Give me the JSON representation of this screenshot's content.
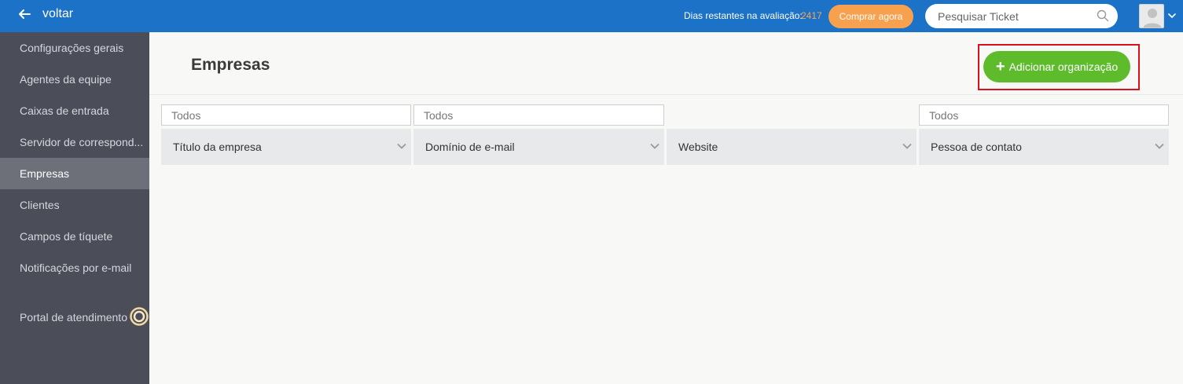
{
  "topbar": {
    "back_label": "voltar",
    "trial_label": "Dias restantes na avaliação:",
    "trial_days": "2417",
    "buy_label": "Comprar agora",
    "search_placeholder": "Pesquisar Ticket"
  },
  "sidebar": {
    "items": [
      {
        "label": "Configurações gerais"
      },
      {
        "label": "Agentes da equipe"
      },
      {
        "label": "Caixas de entrada"
      },
      {
        "label": "Servidor de correspond..."
      },
      {
        "label": "Empresas"
      },
      {
        "label": "Clientes"
      },
      {
        "label": "Campos de tíquete"
      },
      {
        "label": "Notificações por e-mail"
      },
      {
        "label": "Portal de atendimento"
      }
    ],
    "active": "Empresas"
  },
  "page": {
    "title": "Empresas",
    "add_button_label": "Adicionar organização"
  },
  "table": {
    "filters": [
      "Todos",
      "Todos",
      "",
      "Todos"
    ],
    "columns": [
      "Título da empresa",
      "Domínio de e-mail",
      "Website",
      "Pessoa de contato"
    ]
  },
  "colors": {
    "topbar": "#1b72c6",
    "sidebar": "#4b4e59",
    "sidebar_active": "#6d7079",
    "buy_button": "#f7a14f",
    "add_button": "#5dbb2c",
    "highlight": "#d9111b"
  }
}
